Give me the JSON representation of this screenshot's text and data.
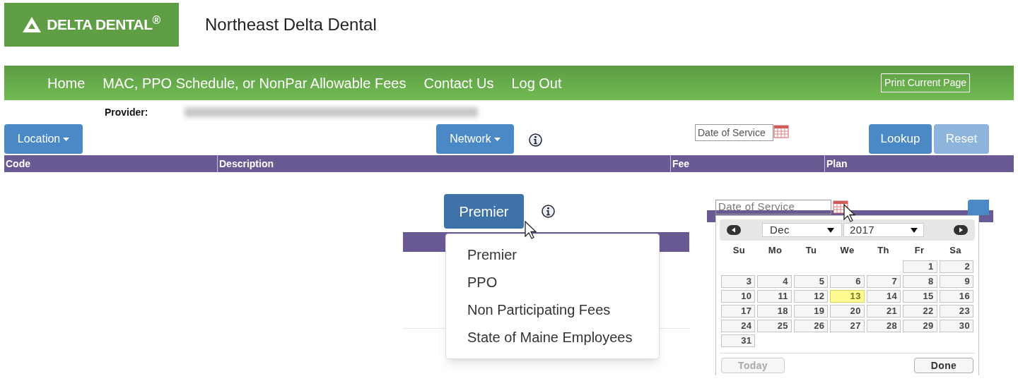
{
  "header": {
    "logo": "DELTA DENTAL$^{®}$",
    "title": "Northeast Delta Dental"
  },
  "nav": {
    "items": [
      "Home",
      "MAC, PPO Schedule, or NonPar Allowable Fees",
      "Contact Us",
      "Log Out"
    ],
    "print_button": "Print Current Page"
  },
  "provider": {
    "label": "Provider:"
  },
  "controls": {
    "location": "Location",
    "network": "Network",
    "date_field": {
      "placeholder": "Date of Service"
    },
    "lookup": {
      "label": "Lookup",
      "disabled": false
    },
    "reset": {
      "label": "Reset",
      "disabled": true
    }
  },
  "table": {
    "columns": [
      "Code",
      "Description",
      "Fee",
      "Plan"
    ]
  },
  "network_dropdown": {
    "button": "Premier",
    "options": [
      "Premier",
      "PPO",
      "Non Participating Fees",
      "State of Maine Employees"
    ]
  },
  "datepicker": {
    "field": {
      "placeholder": "Date of Service"
    },
    "month": "Dec",
    "year": "2017",
    "weekdays": [
      "Su",
      "Mo",
      "Tu",
      "We",
      "Th",
      "Fr",
      "Sa"
    ],
    "weeks": [
      [
        {
          "kind": "blank"
        },
        {
          "kind": "blank"
        },
        {
          "kind": "blank"
        },
        {
          "kind": "blank"
        },
        {
          "kind": "blank"
        },
        {
          "kind": "day",
          "label": "1",
          "today": false
        },
        {
          "kind": "day",
          "label": "2",
          "today": false
        }
      ],
      [
        {
          "kind": "day",
          "label": "3",
          "today": false
        },
        {
          "kind": "day",
          "label": "4",
          "today": false
        },
        {
          "kind": "day",
          "label": "5",
          "today": false
        },
        {
          "kind": "day",
          "label": "6",
          "today": false
        },
        {
          "kind": "day",
          "label": "7",
          "today": false
        },
        {
          "kind": "day",
          "label": "8",
          "today": false
        },
        {
          "kind": "day",
          "label": "9",
          "today": false
        }
      ],
      [
        {
          "kind": "day",
          "label": "10",
          "today": false
        },
        {
          "kind": "day",
          "label": "11",
          "today": false
        },
        {
          "kind": "day",
          "label": "12",
          "today": false
        },
        {
          "kind": "day",
          "label": "13",
          "today": true
        },
        {
          "kind": "day",
          "label": "14",
          "today": false
        },
        {
          "kind": "day",
          "label": "15",
          "today": false
        },
        {
          "kind": "day",
          "label": "16",
          "today": false
        }
      ],
      [
        {
          "kind": "day",
          "label": "17",
          "today": false
        },
        {
          "kind": "day",
          "label": "18",
          "today": false
        },
        {
          "kind": "day",
          "label": "19",
          "today": false
        },
        {
          "kind": "day",
          "label": "20",
          "today": false
        },
        {
          "kind": "day",
          "label": "21",
          "today": false
        },
        {
          "kind": "day",
          "label": "22",
          "today": false
        },
        {
          "kind": "day",
          "label": "23",
          "today": false
        }
      ],
      [
        {
          "kind": "day",
          "label": "24",
          "today": false
        },
        {
          "kind": "day",
          "label": "25",
          "today": false
        },
        {
          "kind": "day",
          "label": "26",
          "today": false
        },
        {
          "kind": "day",
          "label": "27",
          "today": false
        },
        {
          "kind": "day",
          "label": "28",
          "today": false
        },
        {
          "kind": "day",
          "label": "29",
          "today": false
        },
        {
          "kind": "day",
          "label": "30",
          "today": false
        }
      ],
      [
        {
          "kind": "day",
          "label": "31",
          "today": false
        }
      ]
    ],
    "today_button": {
      "label": "Today",
      "disabled": true
    },
    "done_button": "Done"
  }
}
